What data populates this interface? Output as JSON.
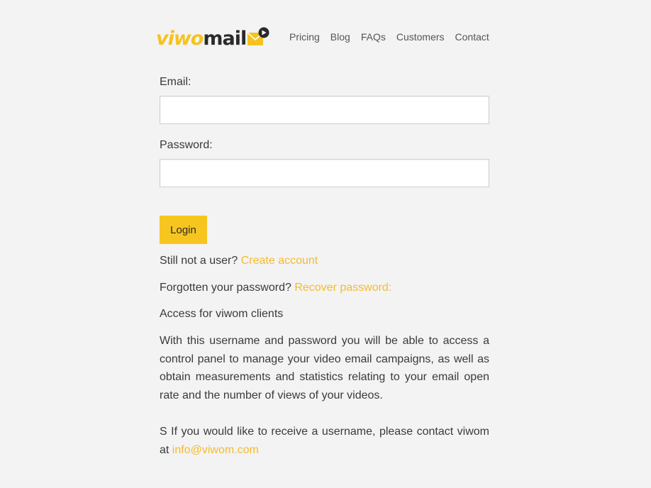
{
  "logo": {
    "part1": "viwo",
    "part2": "mail"
  },
  "nav": {
    "items": [
      "Pricing",
      "Blog",
      "FAQs",
      "Customers",
      "Contact"
    ]
  },
  "form": {
    "email_label": "Email:",
    "email_value": "",
    "password_label": "Password:",
    "password_value": "",
    "login_label": "Login"
  },
  "links": {
    "signup_text": "Still not a user?",
    "signup_link": "Create account",
    "recover_text": "Forgotten your password?",
    "recover_link": "Recover password:"
  },
  "info": {
    "heading": "Access for viwom clients",
    "description": "With this username and password you will be able to access a control panel to manage your video email campaigns, as well as obtain measurements and statistics relating to your email open rate and the number of views of your videos.",
    "contact_text": "S If you would like to receive a username, please contact viwom at",
    "contact_email": "info@viwom.com"
  },
  "colors": {
    "accent": "#f7c51f",
    "link": "#f5bb2e",
    "background": "#f3f3f3",
    "text": "#3a3a3a"
  }
}
